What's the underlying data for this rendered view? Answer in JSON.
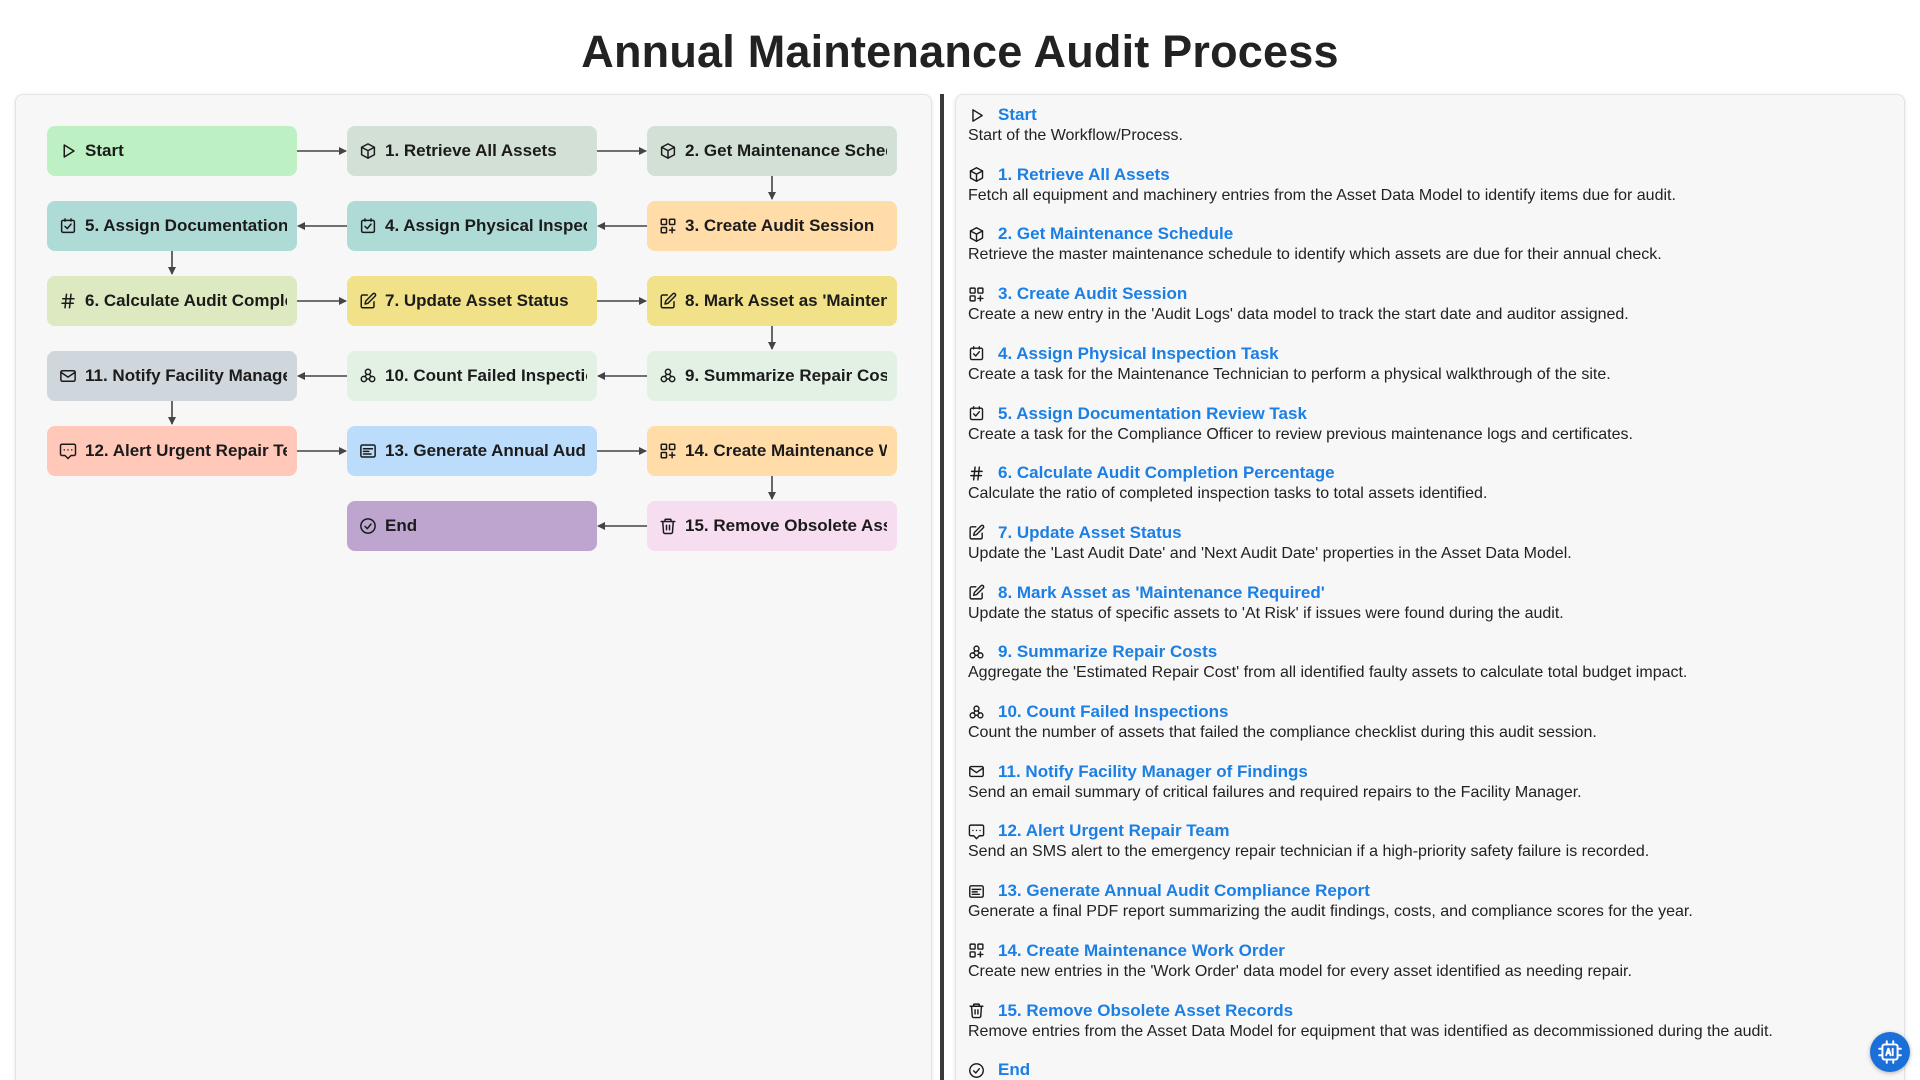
{
  "title": "Annual Maintenance Audit Process",
  "colors": {
    "link": "#1b7fe3",
    "green": "#bdf0c2",
    "grey_green": "#d3e0d6",
    "teal": "#aedbd6",
    "orange": "#ffdca8",
    "lime": "#dde9c0",
    "yellow": "#f1e289",
    "mint": "#e3f1e4",
    "slate": "#cfd6dc",
    "salmon": "#ffc8b8",
    "blue": "#bcdcfb",
    "pink": "#f6ddf0",
    "purple": "#bda5cf"
  },
  "nodes": [
    {
      "id": "start",
      "label": "Start",
      "icon": "play-icon"
    },
    {
      "id": "n1",
      "label": "1. Retrieve All Assets",
      "icon": "cube-icon"
    },
    {
      "id": "n2",
      "label": "2. Get Maintenance Schedule",
      "icon": "cube-icon"
    },
    {
      "id": "n3",
      "label": "3. Create Audit Session",
      "icon": "grid-plus-icon"
    },
    {
      "id": "n4",
      "label": "4. Assign Physical Inspection Task",
      "icon": "checkbox-icon"
    },
    {
      "id": "n5",
      "label": "5. Assign Documentation Review Task",
      "icon": "checkbox-icon"
    },
    {
      "id": "n6",
      "label": "6. Calculate Audit Completion Percentage",
      "icon": "hash-icon"
    },
    {
      "id": "n7",
      "label": "7. Update Asset Status",
      "icon": "edit-icon"
    },
    {
      "id": "n8",
      "label": "8. Mark Asset as 'Maintenance Required'",
      "icon": "edit-icon"
    },
    {
      "id": "n9",
      "label": "9. Summarize Repair Costs",
      "icon": "cluster-icon"
    },
    {
      "id": "n10",
      "label": "10. Count Failed Inspections",
      "icon": "cluster-icon"
    },
    {
      "id": "n11",
      "label": "11. Notify Facility Manager of Findings",
      "icon": "mail-icon"
    },
    {
      "id": "n12",
      "label": "12. Alert Urgent Repair Team",
      "icon": "message-icon"
    },
    {
      "id": "n13",
      "label": "13. Generate Annual Audit Compliance Report",
      "icon": "report-icon"
    },
    {
      "id": "n14",
      "label": "14. Create Maintenance Work Order",
      "icon": "grid-plus-icon"
    },
    {
      "id": "n15",
      "label": "15. Remove Obsolete Asset Records",
      "icon": "trash-icon"
    },
    {
      "id": "end",
      "label": "End",
      "icon": "check-circle-icon"
    }
  ],
  "steps": [
    {
      "title": "Start",
      "icon": "play-icon",
      "desc": "Start of the Workflow/Process."
    },
    {
      "title": "1. Retrieve All Assets",
      "icon": "cube-icon",
      "desc": "Fetch all equipment and machinery entries from the Asset Data Model to identify items due for audit."
    },
    {
      "title": "2. Get Maintenance Schedule",
      "icon": "cube-icon",
      "desc": "Retrieve the master maintenance schedule to identify which assets are due for their annual check."
    },
    {
      "title": "3. Create Audit Session",
      "icon": "grid-plus-icon",
      "desc": "Create a new entry in the 'Audit Logs' data model to track the start date and auditor assigned."
    },
    {
      "title": "4. Assign Physical Inspection Task",
      "icon": "checkbox-icon",
      "desc": "Create a task for the Maintenance Technician to perform a physical walkthrough of the site."
    },
    {
      "title": "5. Assign Documentation Review Task",
      "icon": "checkbox-icon",
      "desc": "Create a task for the Compliance Officer to review previous maintenance logs and certificates."
    },
    {
      "title": "6. Calculate Audit Completion Percentage",
      "icon": "hash-icon",
      "desc": "Calculate the ratio of completed inspection tasks to total assets identified."
    },
    {
      "title": "7. Update Asset Status",
      "icon": "edit-icon",
      "desc": "Update the 'Last Audit Date' and 'Next Audit Date' properties in the Asset Data Model."
    },
    {
      "title": "8. Mark Asset as 'Maintenance Required'",
      "icon": "edit-icon",
      "desc": "Update the status of specific assets to 'At Risk' if issues were found during the audit."
    },
    {
      "title": "9. Summarize Repair Costs",
      "icon": "cluster-icon",
      "desc": "Aggregate the 'Estimated Repair Cost' from all identified faulty assets to calculate total budget impact."
    },
    {
      "title": "10. Count Failed Inspections",
      "icon": "cluster-icon",
      "desc": "Count the number of assets that failed the compliance checklist during this audit session."
    },
    {
      "title": "11. Notify Facility Manager of Findings",
      "icon": "mail-icon",
      "desc": "Send an email summary of critical failures and required repairs to the Facility Manager."
    },
    {
      "title": "12. Alert Urgent Repair Team",
      "icon": "message-icon",
      "desc": "Send an SMS alert to the emergency repair technician if a high-priority safety failure is recorded."
    },
    {
      "title": "13. Generate Annual Audit Compliance Report",
      "icon": "report-icon",
      "desc": "Generate a final PDF report summarizing the audit findings, costs, and compliance scores for the year."
    },
    {
      "title": "14. Create Maintenance Work Order",
      "icon": "grid-plus-icon",
      "desc": "Create new entries in the 'Work Order' data model for every asset identified as needing repair."
    },
    {
      "title": "15. Remove Obsolete Asset Records",
      "icon": "trash-icon",
      "desc": "Remove entries from the Asset Data Model for equipment that was identified as decommissioned during the audit."
    },
    {
      "title": "End",
      "icon": "check-circle-icon",
      "desc": ""
    }
  ],
  "fab": {
    "icon": "ai-chip-icon"
  }
}
